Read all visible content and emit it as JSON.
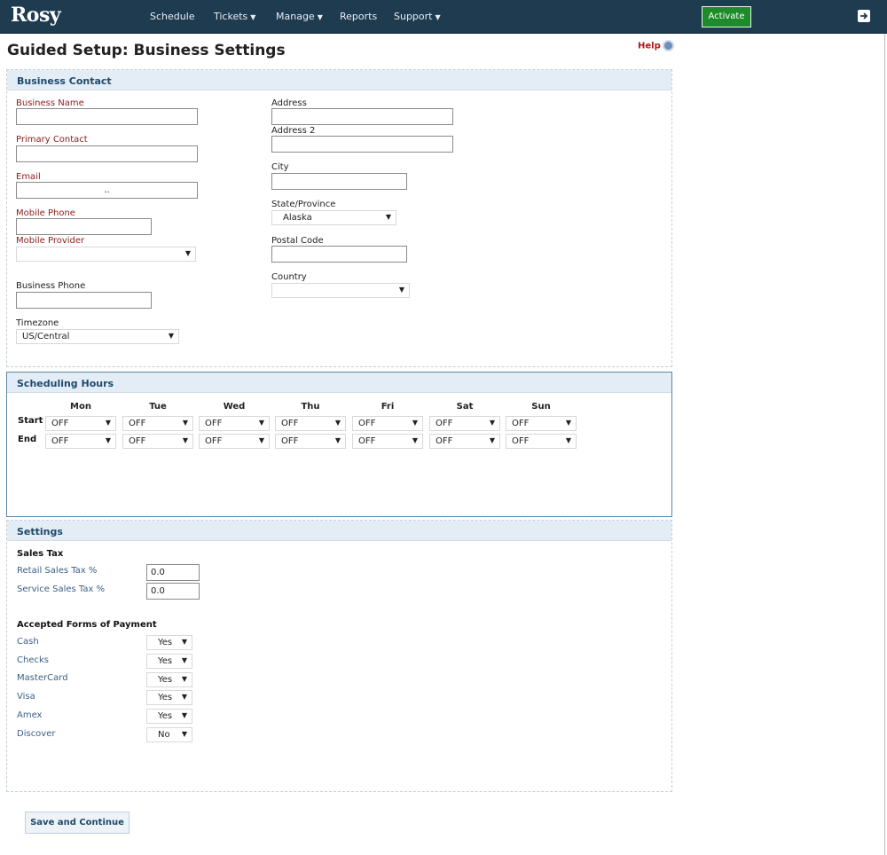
{
  "app": {
    "logo": "Rosy"
  },
  "nav": {
    "items": [
      {
        "label": "Schedule",
        "caret": false
      },
      {
        "label": "Tickets",
        "caret": true
      },
      {
        "label": "Manage",
        "caret": true
      },
      {
        "label": "Reports",
        "caret": false
      },
      {
        "label": "Support",
        "caret": true
      }
    ],
    "activate_label": "Activate"
  },
  "page": {
    "title": "Guided Setup: Business Settings",
    "help_label": "Help"
  },
  "business_contact": {
    "title": "Business Contact",
    "business_name_label": "Business Name",
    "business_name_value": "",
    "primary_contact_label": "Primary Contact",
    "primary_contact_value": "",
    "email_label": "Email",
    "email_value": "..",
    "mobile_phone_label": "Mobile Phone",
    "mobile_phone_value": "",
    "mobile_provider_label": "Mobile Provider",
    "mobile_provider_value": "",
    "business_phone_label": "Business Phone",
    "business_phone_value": "",
    "timezone_label": "Timezone",
    "timezone_value": "US/Central",
    "address_label": "Address",
    "address_value": "",
    "address2_label": "Address 2",
    "address2_value": "",
    "city_label": "City",
    "city_value": "",
    "state_label": "State/Province",
    "state_value": "Alaska",
    "postal_label": "Postal Code",
    "postal_value": "",
    "country_label": "Country",
    "country_value": ""
  },
  "hours": {
    "title": "Scheduling Hours",
    "start_label": "Start",
    "end_label": "End",
    "days": [
      {
        "name": "Mon",
        "start": "OFF",
        "end": "OFF"
      },
      {
        "name": "Tue",
        "start": "OFF",
        "end": "OFF"
      },
      {
        "name": "Wed",
        "start": "OFF",
        "end": "OFF"
      },
      {
        "name": "Thu",
        "start": "OFF",
        "end": "OFF"
      },
      {
        "name": "Fri",
        "start": "OFF",
        "end": "OFF"
      },
      {
        "name": "Sat",
        "start": "OFF",
        "end": "OFF"
      },
      {
        "name": "Sun",
        "start": "OFF",
        "end": "OFF"
      }
    ]
  },
  "settings": {
    "title": "Settings",
    "sales_tax_heading": "Sales Tax",
    "retail_tax_label": "Retail Sales Tax %",
    "retail_tax_value": "0.0",
    "service_tax_label": "Service Sales Tax %",
    "service_tax_value": "0.0",
    "payment_heading": "Accepted Forms of Payment",
    "payments": [
      {
        "label": "Cash",
        "value": "Yes"
      },
      {
        "label": "Checks",
        "value": "Yes"
      },
      {
        "label": "MasterCard",
        "value": "Yes"
      },
      {
        "label": "Visa",
        "value": "Yes"
      },
      {
        "label": "Amex",
        "value": "Yes"
      },
      {
        "label": "Discover",
        "value": "No"
      }
    ]
  },
  "footer": {
    "save_label": "Save and Continue"
  },
  "colors": {
    "navbar": "#1f3b50",
    "activate": "#1e8b2a",
    "required": "#8b1c1c",
    "section_title": "#1d4a6b"
  }
}
